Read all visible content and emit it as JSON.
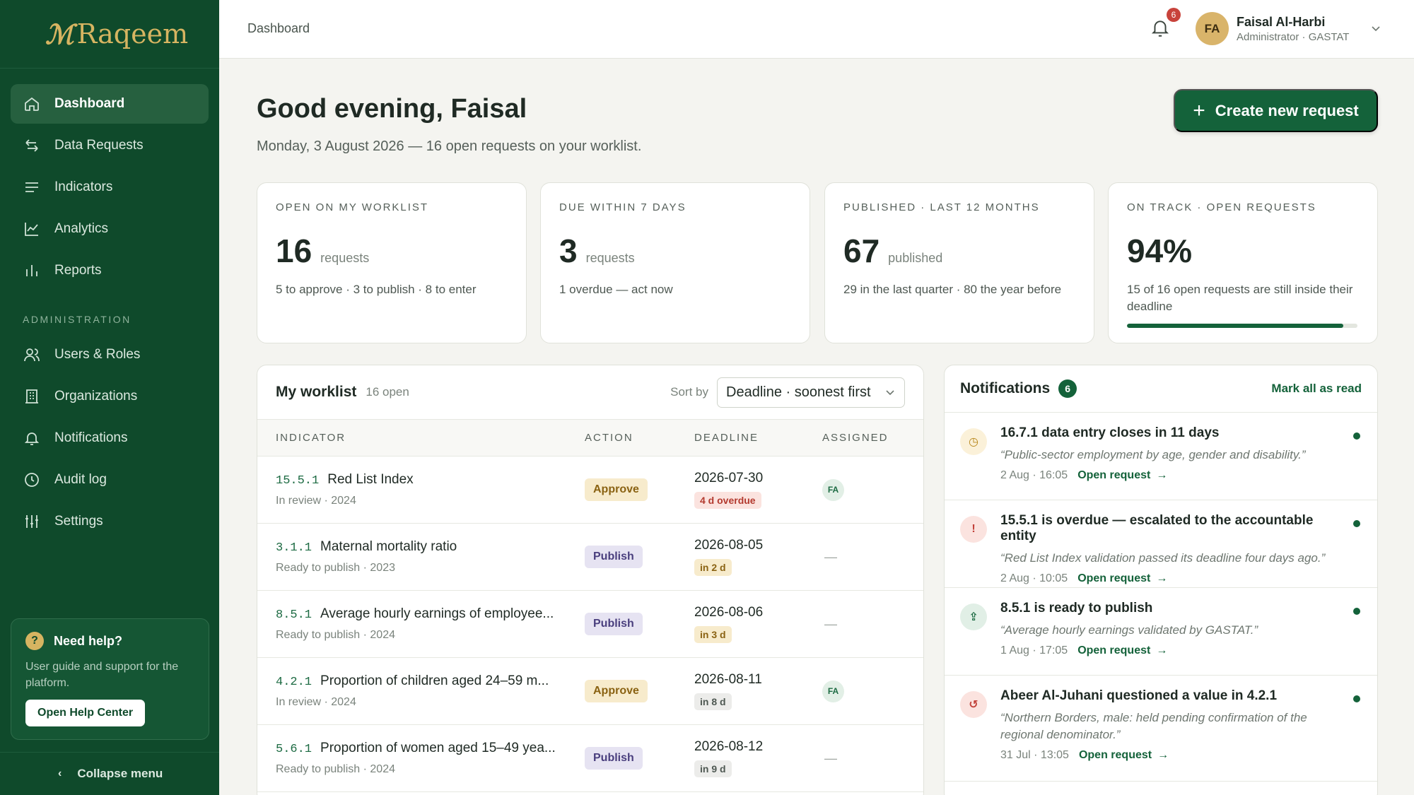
{
  "brand": {
    "logo_mark": "ℳ",
    "logo_text": "Raqeem",
    "color": "#d6b461"
  },
  "sidebar": {
    "items": [
      {
        "label": "Dashboard",
        "icon": "home-icon",
        "active": true
      },
      {
        "label": "Data Requests",
        "icon": "swap-icon"
      },
      {
        "label": "Indicators",
        "icon": "list-icon"
      },
      {
        "label": "Analytics",
        "icon": "line-chart-icon"
      },
      {
        "label": "Reports",
        "icon": "bar-chart-icon"
      }
    ],
    "admin_section": "ADMINISTRATION",
    "admin_items": [
      {
        "label": "Users & Roles",
        "icon": "users-icon"
      },
      {
        "label": "Organizations",
        "icon": "building-icon"
      },
      {
        "label": "Notifications",
        "icon": "bell-icon"
      },
      {
        "label": "Audit log",
        "icon": "clock-icon"
      },
      {
        "label": "Settings",
        "icon": "sliders-icon"
      }
    ],
    "help": {
      "icon": "?",
      "title": "Need help?",
      "desc": "User guide and support for the platform.",
      "button": "Open Help Center"
    },
    "collapse": {
      "chevron": "‹",
      "label": "Collapse menu"
    }
  },
  "topbar": {
    "breadcrumb": "Dashboard",
    "bell_count": "6",
    "user": {
      "initials": "FA",
      "name": "Faisal Al-Harbi",
      "role": "Administrator · GASTAT"
    }
  },
  "main": {
    "greeting": "Good evening, Faisal",
    "subline": "Monday, 3 August 2026 — 16 open requests on your worklist.",
    "create_button": {
      "plus": "+",
      "label": "Create new request"
    }
  },
  "kpis": [
    {
      "label": "OPEN ON MY WORKLIST",
      "value": "16",
      "unit": "requests",
      "sub": "5 to approve · 3 to publish · 8 to enter"
    },
    {
      "label": "DUE WITHIN 7 DAYS",
      "value": "3",
      "unit": "requests",
      "sub": "1 overdue — act now"
    },
    {
      "label": "PUBLISHED · LAST 12 MONTHS",
      "value": "67",
      "unit": "published",
      "sub": "29 in the last quarter · 80 the year before"
    },
    {
      "label": "ON TRACK · OPEN REQUESTS",
      "value": "94%",
      "unit": "",
      "sub": "15 of 16 open requests are still inside their deadline",
      "progress": 0.94
    }
  ],
  "worklist": {
    "title": "My worklist",
    "count": "16 open",
    "sort_label": "Sort by",
    "sort_value": "Deadline · soonest first",
    "columns": [
      "INDICATOR",
      "ACTION",
      "DEADLINE",
      "ASSIGNED"
    ],
    "rows": [
      {
        "code": "15.5.1",
        "name": "Red List Index",
        "meta": "In review · 2024",
        "action": "Approve",
        "action_type": "approve",
        "date": "2026-07-30",
        "tag": "4 d overdue",
        "tag_type": "over",
        "assigned": "FA"
      },
      {
        "code": "3.1.1",
        "name": "Maternal mortality ratio",
        "meta": "Ready to publish · 2023",
        "action": "Publish",
        "action_type": "publish",
        "date": "2026-08-05",
        "tag": "in 2 d",
        "tag_type": "soon",
        "assigned": "—"
      },
      {
        "code": "8.5.1",
        "name": "Average hourly earnings of employee...",
        "meta": "Ready to publish · 2024",
        "action": "Publish",
        "action_type": "publish",
        "date": "2026-08-06",
        "tag": "in 3 d",
        "tag_type": "soon",
        "assigned": "—"
      },
      {
        "code": "4.2.1",
        "name": "Proportion of children aged 24–59 m...",
        "meta": "In review · 2024",
        "action": "Approve",
        "action_type": "approve",
        "date": "2026-08-11",
        "tag": "in 8 d",
        "tag_type": "norm",
        "assigned": "FA"
      },
      {
        "code": "5.6.1",
        "name": "Proportion of women aged 15–49 yea...",
        "meta": "Ready to publish · 2024",
        "action": "Publish",
        "action_type": "publish",
        "date": "2026-08-12",
        "tag": "in 9 d",
        "tag_type": "norm",
        "assigned": "—"
      }
    ]
  },
  "notifications": {
    "title": "Notifications",
    "count": "6",
    "mark_all": "Mark all as read",
    "link_label": "Open request",
    "items": [
      {
        "icon": "clock-icon",
        "glyph": "◷",
        "type": "clock",
        "text": "16.7.1 data entry closes in 11 days",
        "quote": "“Public-sector employment by age, gender and disability.”",
        "time": "2 Aug · 16:05"
      },
      {
        "icon": "alert-icon",
        "glyph": "!",
        "type": "alert",
        "text": "15.5.1 is overdue — escalated to the accountable entity",
        "quote": "“Red List Index validation passed its deadline four days ago.”",
        "time": "2 Aug · 10:05"
      },
      {
        "icon": "publish-icon",
        "glyph": "⇪",
        "type": "pub",
        "text": "8.5.1 is ready to publish",
        "quote": "“Average hourly earnings validated by GASTAT.”",
        "time": "1 Aug · 17:05"
      },
      {
        "icon": "undo-icon",
        "glyph": "↺",
        "type": "undo",
        "text": "Abeer Al-Juhani questioned a value in 4.2.1",
        "quote": "“Northern Borders, male: held pending confirmation of the regional denominator.”",
        "time": "31 Jul · 13:05"
      }
    ]
  }
}
